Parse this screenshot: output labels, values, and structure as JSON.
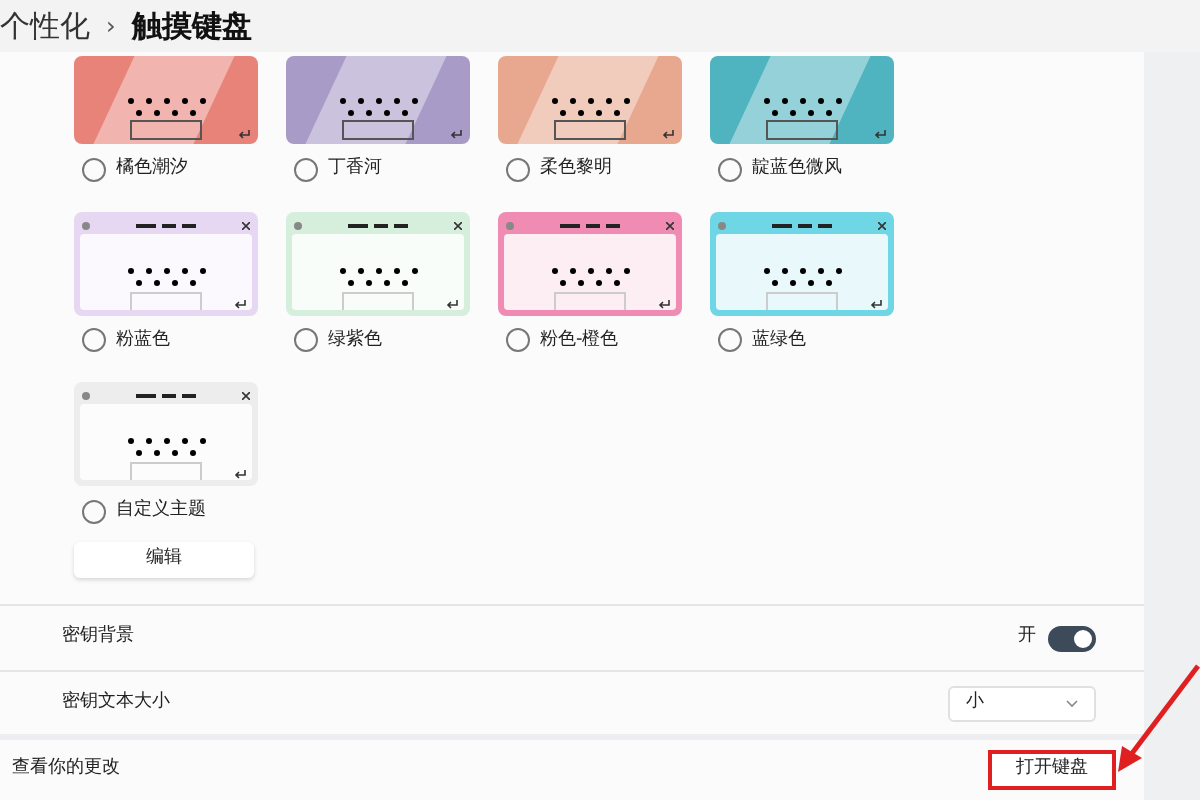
{
  "breadcrumb": {
    "parent": "个性化",
    "separator": "›",
    "current": "触摸键盘"
  },
  "themes": [
    {
      "label": "橘色潮汐",
      "kind": "scenic",
      "color": "#e8837a",
      "selected": false
    },
    {
      "label": "丁香河",
      "kind": "scenic",
      "color": "#a99bc8",
      "selected": false
    },
    {
      "label": "柔色黎明",
      "kind": "scenic",
      "color": "#e8a890",
      "selected": false
    },
    {
      "label": "靛蓝色微风",
      "kind": "scenic",
      "color": "#4fb3c0",
      "selected": false
    },
    {
      "label": "粉蓝色",
      "kind": "framed",
      "color": "#e6d8f2",
      "selected": false
    },
    {
      "label": "绿紫色",
      "kind": "framed",
      "color": "#d6efdd",
      "selected": false
    },
    {
      "label": "粉色-橙色",
      "kind": "framed",
      "color": "#f08cb4",
      "selected": false
    },
    {
      "label": "蓝绿色",
      "kind": "framed",
      "color": "#6fd6e6",
      "selected": false
    },
    {
      "label": "自定义主题",
      "kind": "framed",
      "color": "#ededed",
      "selected": false
    }
  ],
  "edit_button": "编辑",
  "key_background": {
    "label": "密钥背景",
    "state_text": "开",
    "on": true
  },
  "key_text_size": {
    "label": "密钥文本大小",
    "value": "小"
  },
  "review": {
    "label": "查看你的更改",
    "button": "打开键盘"
  }
}
